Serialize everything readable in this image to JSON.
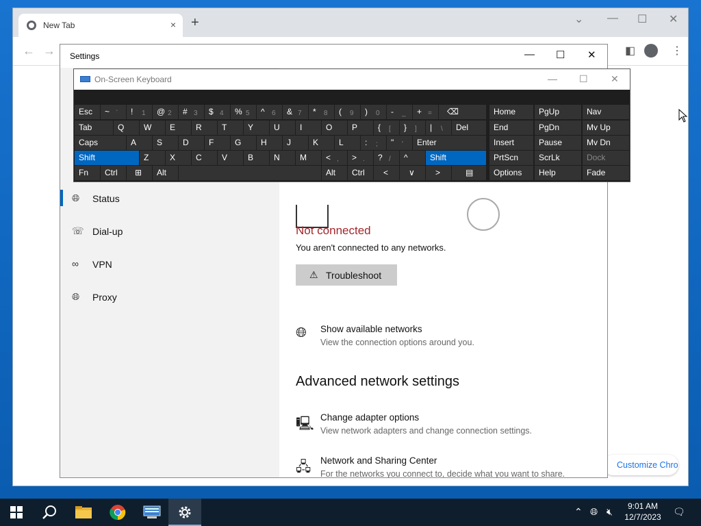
{
  "chrome": {
    "tab_title": "New Tab",
    "tab_close": "×",
    "new_tab": "+",
    "back": "←",
    "forward": "→",
    "customize_label": "Customize Chrome"
  },
  "settings": {
    "window_title": "Settings",
    "nav": [
      {
        "label": "Status",
        "icon": "globe-icon",
        "active": true
      },
      {
        "label": "Dial-up",
        "icon": "dialup-icon",
        "active": false
      },
      {
        "label": "VPN",
        "icon": "vpn-icon",
        "active": false
      },
      {
        "label": "Proxy",
        "icon": "globe-icon",
        "active": false
      }
    ],
    "status_title": "Not connected",
    "status_sub": "You aren't connected to any networks.",
    "troubleshoot_label": "Troubleshoot",
    "show_networks": {
      "title": "Show available networks",
      "sub": "View the connection options around you."
    },
    "advanced_heading": "Advanced network settings",
    "adapter": {
      "title": "Change adapter options",
      "sub": "View network adapters and change connection settings."
    },
    "sharing": {
      "title": "Network and Sharing Center",
      "sub": "For the networks you connect to, decide what you want to share."
    },
    "accent_color": "#0067c0",
    "error_color": "#a4262c"
  },
  "osk": {
    "title": "On-Screen Keyboard",
    "keys": {
      "esc": "Esc",
      "tilde": "~",
      "tilde_s": "`",
      "n1": "!",
      "n1s": "1",
      "n2": "@",
      "n2s": "2",
      "n3": "#",
      "n3s": "3",
      "n4": "$",
      "n4s": "4",
      "n5": "%",
      "n5s": "5",
      "n6": "^",
      "n6s": "6",
      "n7": "&",
      "n7s": "7",
      "n8": "*",
      "n8s": "8",
      "n9": "(",
      "n9s": "9",
      "n0": ")",
      "n0s": "0",
      "minus": "_",
      "minus_s": "-",
      "plus": "+",
      "plus_s": "=",
      "bksp": "⌫",
      "tab": "Tab",
      "q": "Q",
      "w": "W",
      "e": "E",
      "r": "R",
      "t": "T",
      "y": "Y",
      "u": "U",
      "i": "I",
      "o": "O",
      "p": "P",
      "lbr": "{",
      "lbr_s": "[",
      "rbr": "}",
      "rbr_s": "]",
      "pipe": "|",
      "pipe_s": "\\",
      "del": "Del",
      "caps": "Caps",
      "a": "A",
      "s": "S",
      "d": "D",
      "f": "F",
      "g": "G",
      "h": "H",
      "j": "J",
      "k": "K",
      "l": "L",
      "colon": ":",
      "colon_s": ";",
      "quote": "\"",
      "quote_s": "'",
      "enter": "Enter",
      "shift": "Shift",
      "z": "Z",
      "x": "X",
      "c": "C",
      "v": "V",
      "b": "B",
      "n": "N",
      "m": "M",
      "lt": "<",
      "lt_s": ",",
      "gt": ">",
      "gt_s": ".",
      "qm": "?",
      "qm_s": "/",
      "up": "^",
      "fn": "Fn",
      "ctrl": "Ctrl",
      "alt": "Alt",
      "left": "<",
      "down": "∨",
      "right": ">",
      "menu": "▤",
      "home": "Home",
      "pgup": "PgUp",
      "nav": "Nav",
      "end": "End",
      "pgdn": "PgDn",
      "mvup": "Mv Up",
      "insert": "Insert",
      "pause": "Pause",
      "mvdn": "Mv Dn",
      "prtscn": "PrtScn",
      "scrlk": "ScrLk",
      "dock": "Dock",
      "options": "Options",
      "help": "Help",
      "fade": "Fade"
    }
  },
  "taskbar": {
    "time": "9:01 AM",
    "date": "12/7/2023"
  }
}
